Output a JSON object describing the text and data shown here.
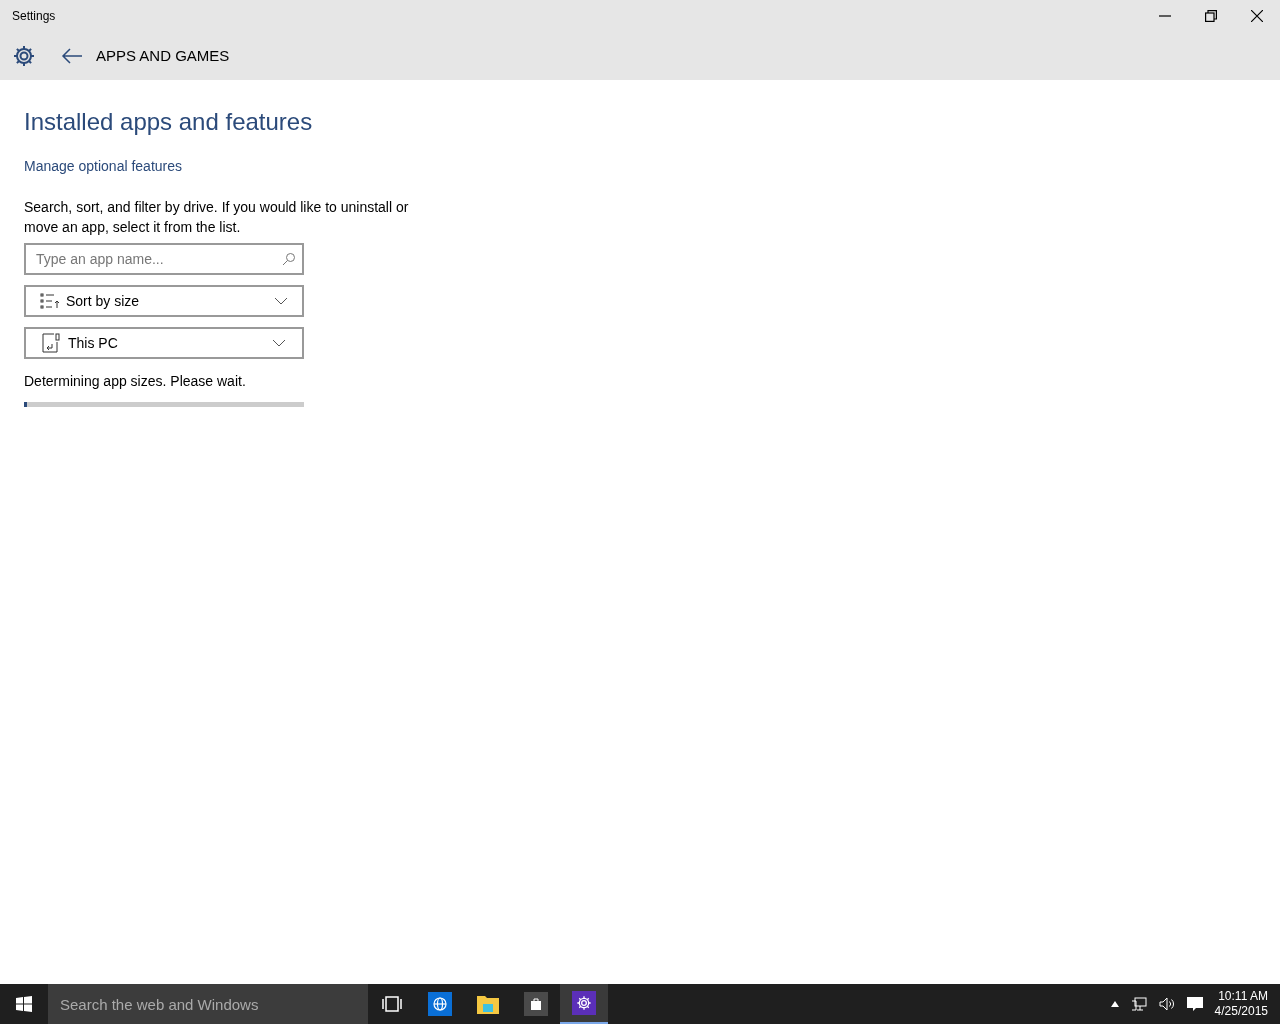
{
  "window": {
    "title": "Settings"
  },
  "header": {
    "section": "APPS AND GAMES"
  },
  "page": {
    "heading": "Installed apps and features",
    "link": "Manage optional features",
    "description": "Search, sort, and filter by drive. If you would like to uninstall or move an app, select it from the list.",
    "search": {
      "placeholder": "Type an app name..."
    },
    "sort": {
      "value": "Sort by size"
    },
    "drive": {
      "value": "This PC"
    },
    "status": "Determining app sizes. Please wait.",
    "progress": {
      "level": 0.01
    }
  },
  "taskbar": {
    "search": {
      "placeholder": "Search the web and Windows"
    },
    "apps": [
      {
        "kind": "taskview",
        "selected": false
      },
      {
        "kind": "browser",
        "selected": false
      },
      {
        "kind": "explorer",
        "selected": false
      },
      {
        "kind": "store",
        "selected": false
      },
      {
        "kind": "settings",
        "selected": true
      }
    ],
    "time": "10:11 AM",
    "date": "4/25/2015"
  }
}
